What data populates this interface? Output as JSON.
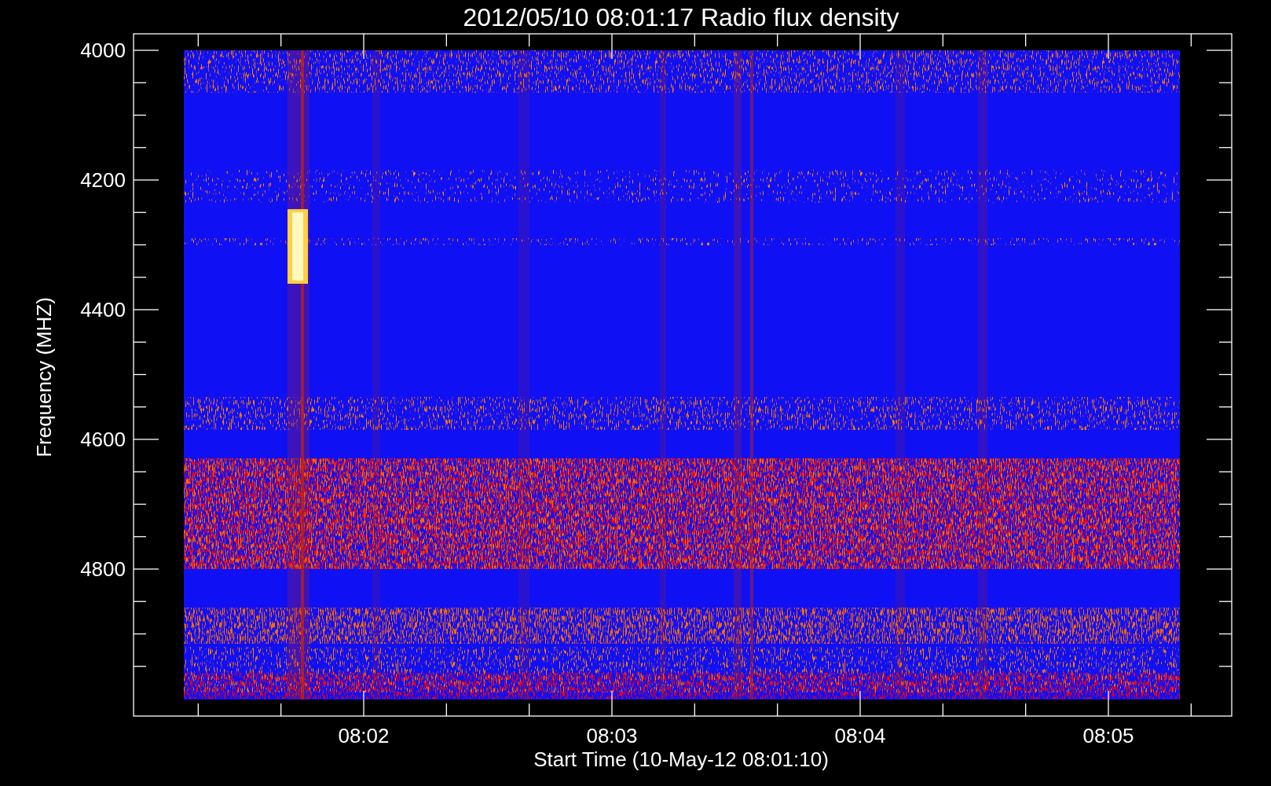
{
  "plot": {
    "title": "2012/05/10 08:01:17 Radio flux density",
    "y_axis": {
      "label": "Frequency (MHZ)",
      "ticks": [
        "4000",
        "4200",
        "4400",
        "4600",
        "4800"
      ]
    },
    "x_axis": {
      "label": "Start Time (10-May-12 08:01:10)",
      "ticks": [
        "08:02",
        "08:03",
        "08:04",
        "08:05"
      ]
    }
  }
}
